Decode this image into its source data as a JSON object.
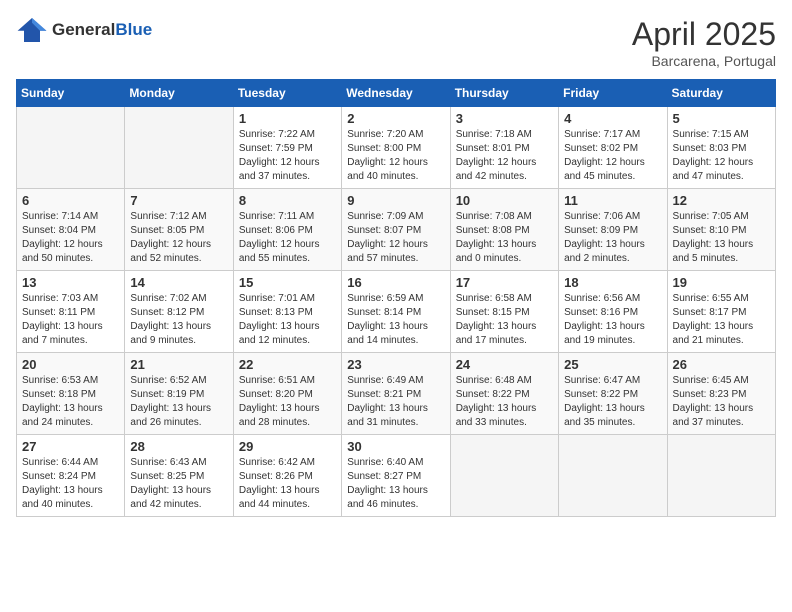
{
  "header": {
    "logo_general": "General",
    "logo_blue": "Blue",
    "month": "April 2025",
    "location": "Barcarena, Portugal"
  },
  "weekdays": [
    "Sunday",
    "Monday",
    "Tuesday",
    "Wednesday",
    "Thursday",
    "Friday",
    "Saturday"
  ],
  "weeks": [
    [
      {
        "day": "",
        "info": ""
      },
      {
        "day": "",
        "info": ""
      },
      {
        "day": "1",
        "info": "Sunrise: 7:22 AM\nSunset: 7:59 PM\nDaylight: 12 hours and 37 minutes."
      },
      {
        "day": "2",
        "info": "Sunrise: 7:20 AM\nSunset: 8:00 PM\nDaylight: 12 hours and 40 minutes."
      },
      {
        "day": "3",
        "info": "Sunrise: 7:18 AM\nSunset: 8:01 PM\nDaylight: 12 hours and 42 minutes."
      },
      {
        "day": "4",
        "info": "Sunrise: 7:17 AM\nSunset: 8:02 PM\nDaylight: 12 hours and 45 minutes."
      },
      {
        "day": "5",
        "info": "Sunrise: 7:15 AM\nSunset: 8:03 PM\nDaylight: 12 hours and 47 minutes."
      }
    ],
    [
      {
        "day": "6",
        "info": "Sunrise: 7:14 AM\nSunset: 8:04 PM\nDaylight: 12 hours and 50 minutes."
      },
      {
        "day": "7",
        "info": "Sunrise: 7:12 AM\nSunset: 8:05 PM\nDaylight: 12 hours and 52 minutes."
      },
      {
        "day": "8",
        "info": "Sunrise: 7:11 AM\nSunset: 8:06 PM\nDaylight: 12 hours and 55 minutes."
      },
      {
        "day": "9",
        "info": "Sunrise: 7:09 AM\nSunset: 8:07 PM\nDaylight: 12 hours and 57 minutes."
      },
      {
        "day": "10",
        "info": "Sunrise: 7:08 AM\nSunset: 8:08 PM\nDaylight: 13 hours and 0 minutes."
      },
      {
        "day": "11",
        "info": "Sunrise: 7:06 AM\nSunset: 8:09 PM\nDaylight: 13 hours and 2 minutes."
      },
      {
        "day": "12",
        "info": "Sunrise: 7:05 AM\nSunset: 8:10 PM\nDaylight: 13 hours and 5 minutes."
      }
    ],
    [
      {
        "day": "13",
        "info": "Sunrise: 7:03 AM\nSunset: 8:11 PM\nDaylight: 13 hours and 7 minutes."
      },
      {
        "day": "14",
        "info": "Sunrise: 7:02 AM\nSunset: 8:12 PM\nDaylight: 13 hours and 9 minutes."
      },
      {
        "day": "15",
        "info": "Sunrise: 7:01 AM\nSunset: 8:13 PM\nDaylight: 13 hours and 12 minutes."
      },
      {
        "day": "16",
        "info": "Sunrise: 6:59 AM\nSunset: 8:14 PM\nDaylight: 13 hours and 14 minutes."
      },
      {
        "day": "17",
        "info": "Sunrise: 6:58 AM\nSunset: 8:15 PM\nDaylight: 13 hours and 17 minutes."
      },
      {
        "day": "18",
        "info": "Sunrise: 6:56 AM\nSunset: 8:16 PM\nDaylight: 13 hours and 19 minutes."
      },
      {
        "day": "19",
        "info": "Sunrise: 6:55 AM\nSunset: 8:17 PM\nDaylight: 13 hours and 21 minutes."
      }
    ],
    [
      {
        "day": "20",
        "info": "Sunrise: 6:53 AM\nSunset: 8:18 PM\nDaylight: 13 hours and 24 minutes."
      },
      {
        "day": "21",
        "info": "Sunrise: 6:52 AM\nSunset: 8:19 PM\nDaylight: 13 hours and 26 minutes."
      },
      {
        "day": "22",
        "info": "Sunrise: 6:51 AM\nSunset: 8:20 PM\nDaylight: 13 hours and 28 minutes."
      },
      {
        "day": "23",
        "info": "Sunrise: 6:49 AM\nSunset: 8:21 PM\nDaylight: 13 hours and 31 minutes."
      },
      {
        "day": "24",
        "info": "Sunrise: 6:48 AM\nSunset: 8:22 PM\nDaylight: 13 hours and 33 minutes."
      },
      {
        "day": "25",
        "info": "Sunrise: 6:47 AM\nSunset: 8:22 PM\nDaylight: 13 hours and 35 minutes."
      },
      {
        "day": "26",
        "info": "Sunrise: 6:45 AM\nSunset: 8:23 PM\nDaylight: 13 hours and 37 minutes."
      }
    ],
    [
      {
        "day": "27",
        "info": "Sunrise: 6:44 AM\nSunset: 8:24 PM\nDaylight: 13 hours and 40 minutes."
      },
      {
        "day": "28",
        "info": "Sunrise: 6:43 AM\nSunset: 8:25 PM\nDaylight: 13 hours and 42 minutes."
      },
      {
        "day": "29",
        "info": "Sunrise: 6:42 AM\nSunset: 8:26 PM\nDaylight: 13 hours and 44 minutes."
      },
      {
        "day": "30",
        "info": "Sunrise: 6:40 AM\nSunset: 8:27 PM\nDaylight: 13 hours and 46 minutes."
      },
      {
        "day": "",
        "info": ""
      },
      {
        "day": "",
        "info": ""
      },
      {
        "day": "",
        "info": ""
      }
    ]
  ]
}
